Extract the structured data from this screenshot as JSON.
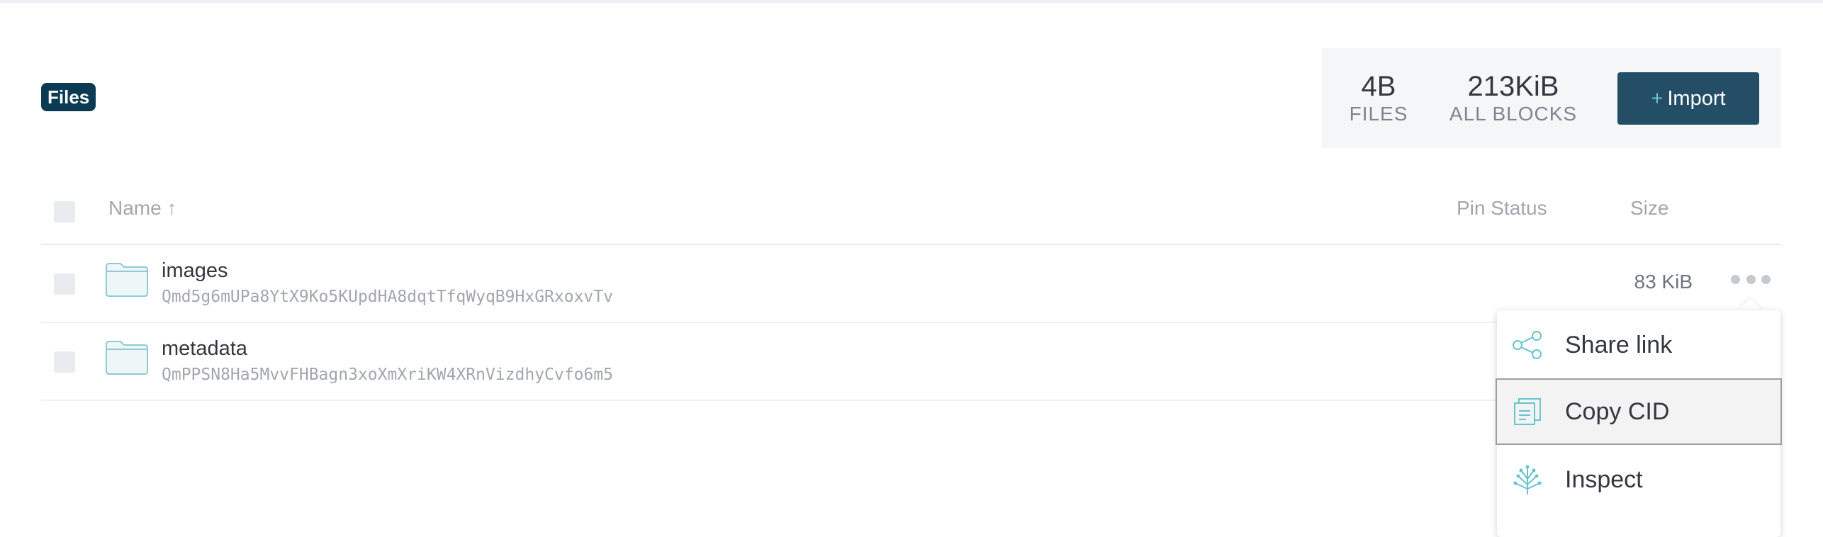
{
  "header": {
    "badge": "Files"
  },
  "stats": {
    "files_value": "4B",
    "files_label": "FILES",
    "blocks_value": "213KiB",
    "blocks_label": "ALL BLOCKS",
    "import_plus": "+",
    "import_label": "Import"
  },
  "table": {
    "columns": {
      "name": "Name ↑",
      "pin_status": "Pin Status",
      "size": "Size"
    },
    "rows": [
      {
        "name": "images",
        "cid": "Qmd5g6mUPa8YtX9Ko5KUpdHA8dqtTfqWyqB9HxGRxoxvTv",
        "size": "83 KiB",
        "icon": "folder-icon"
      },
      {
        "name": "metadata",
        "cid": "QmPPSN8Ha5MvvFHBagn3xoXmXriKW4XRnVizdhyCvfo6m5",
        "size": "",
        "icon": "folder-icon"
      }
    ]
  },
  "context_menu": {
    "items": [
      {
        "label": "Share link",
        "icon": "share-icon"
      },
      {
        "label": "Copy CID",
        "icon": "copy-icon"
      },
      {
        "label": "Inspect",
        "icon": "inspect-tree-icon"
      }
    ]
  },
  "colors": {
    "badge_bg": "#0b3a53",
    "import_bg": "#244e66",
    "accent_teal": "#69c4cd",
    "muted_text": "#a2a6ae"
  }
}
